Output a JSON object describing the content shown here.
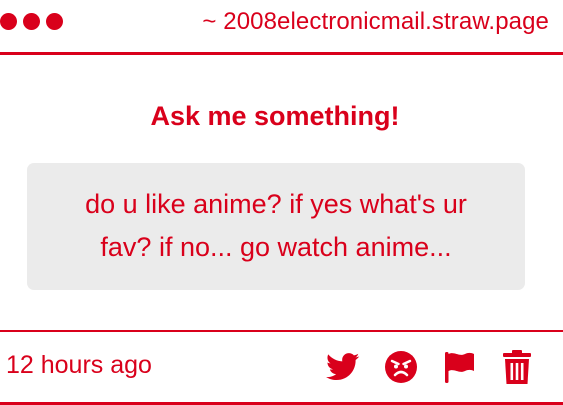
{
  "header": {
    "window_dots": 3,
    "url": "~ 2008electronicmail.straw.page"
  },
  "main": {
    "prompt": "Ask me something!",
    "question": "do u like anime? if yes what's ur fav? if no... go watch anime..."
  },
  "footer": {
    "timestamp": "12 hours ago",
    "actions": [
      {
        "name": "share-twitter",
        "icon": "twitter-bird-icon"
      },
      {
        "name": "react-angry",
        "icon": "angry-face-icon"
      },
      {
        "name": "report",
        "icon": "flag-icon"
      },
      {
        "name": "delete",
        "icon": "trash-icon"
      }
    ]
  },
  "colors": {
    "accent": "#d9001b",
    "question_bg": "#ebebeb",
    "background": "#ffffff"
  }
}
